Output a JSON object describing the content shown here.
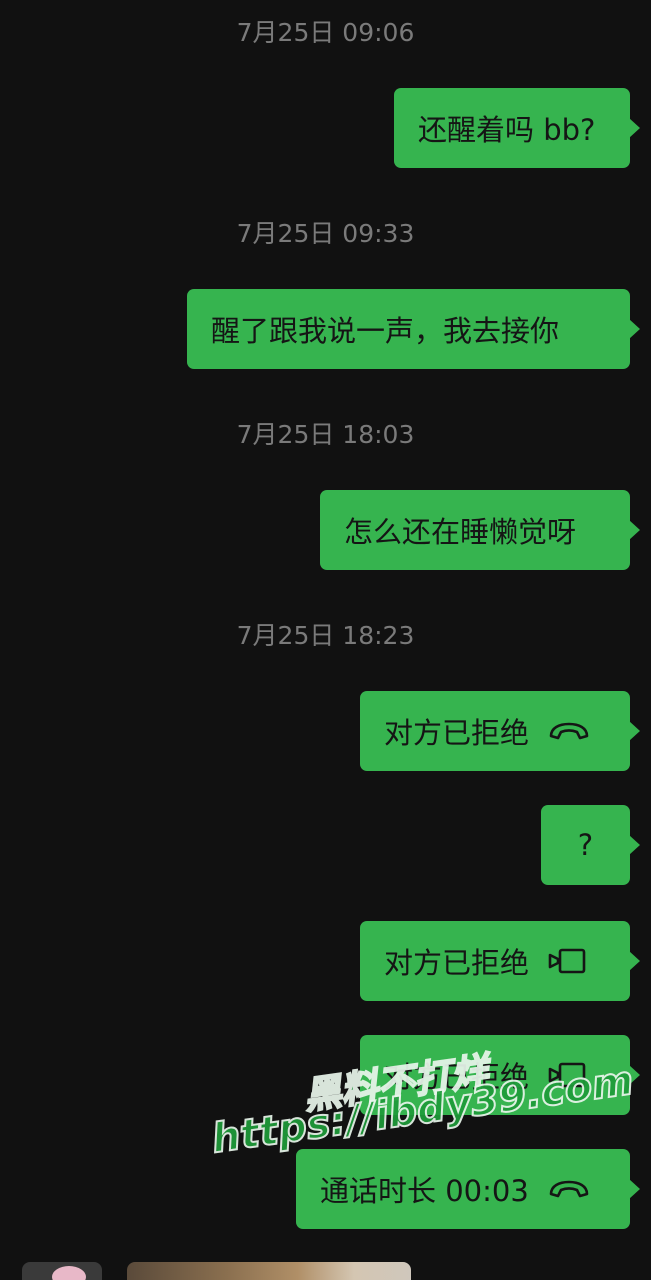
{
  "messages": [
    {
      "time": "7月25日 09:06",
      "text": "还醒着吗 bb?"
    },
    {
      "time": "7月25日 09:33",
      "text": "醒了跟我说一声，我去接你"
    },
    {
      "time": "7月25日 18:03",
      "text": "怎么还在睡懒觉呀"
    },
    {
      "time": "7月25日 18:23",
      "text": "对方已拒绝",
      "icon": "phone-hangup-icon"
    },
    {
      "text": "?"
    },
    {
      "text": "对方已拒绝",
      "icon": "video-call-icon"
    },
    {
      "text": "对方已拒绝",
      "icon": "video-call-icon"
    },
    {
      "text": "通话时长 00:03",
      "icon": "phone-hangup-icon"
    }
  ],
  "watermark": {
    "line1": "黑料不打烊",
    "line2": "https://ibdy39.com"
  },
  "colors": {
    "background": "#111111",
    "bubble": "#36b44f",
    "timestamp": "#7a7a7a"
  }
}
